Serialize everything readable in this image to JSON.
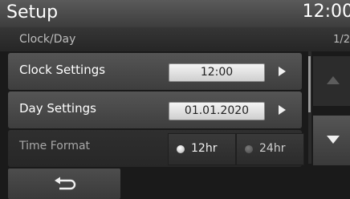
{
  "header": {
    "title": "Setup",
    "clock": "12:00"
  },
  "subheader": {
    "title": "Clock/Day",
    "page": "1/2"
  },
  "rows": {
    "clock_settings": {
      "label": "Clock Settings",
      "value": "12:00"
    },
    "day_settings": {
      "label": "Day Settings",
      "value": "01.01.2020"
    },
    "time_format": {
      "label": "Time Format",
      "options": [
        "12hr",
        "24hr"
      ],
      "selected": "12hr"
    }
  },
  "icons": {
    "row_arrow": "chevron-right-icon",
    "scroll_up": "arrow-up-icon",
    "scroll_down": "arrow-down-icon",
    "back": "back-return-icon"
  }
}
